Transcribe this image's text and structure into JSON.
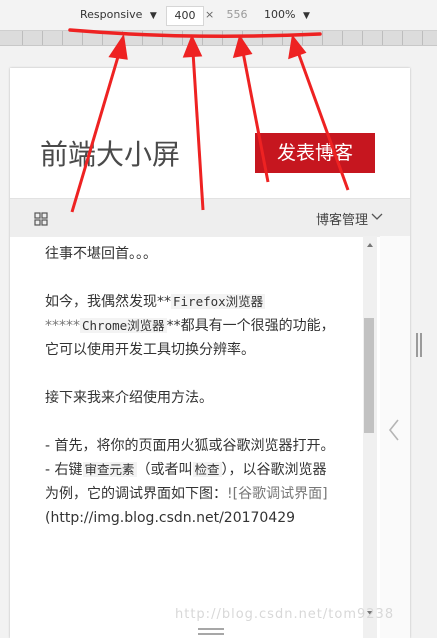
{
  "toolbar": {
    "device_mode": "Responsive",
    "width": "400",
    "times": "×",
    "height": "556",
    "zoom": "100%"
  },
  "page": {
    "brand_text": "前端大小屏",
    "post_button": "发表博客",
    "manage_label": "博客管理"
  },
  "article": {
    "p1": "往事不堪回首。。。",
    "p2_a": "如今，我偶然发现**",
    "p2_code1": "Firefox浏览器",
    "p2_b": "*****",
    "p2_code2": "Chrome浏览器",
    "p2_c": "**都具有一个很强的功能，它可以使用开发工具切换分辨率。",
    "p3": "接下来我来介绍使用方法。",
    "p4": "- 首先，将你的页面用火狐或谷歌浏览器打开。",
    "p5_a": "- 右键",
    "p5_code1": "审查元素",
    "p5_b": "（或者叫",
    "p5_code2": "检查",
    "p5_c": "），以谷歌浏览器为例，它的调试界面如下图：",
    "p5_d": "![谷歌调试界面]",
    "p6": "(http://img.blog.csdn.net/20170429"
  },
  "watermark": "http://blog.csdn.net/tom9238",
  "colors": {
    "accent_red": "#c6161f",
    "annotation_red": "#ee2222"
  },
  "icons": [
    "chevron-down-icon",
    "grid-icon",
    "chevron-left-icon",
    "drag-handle-icon"
  ]
}
